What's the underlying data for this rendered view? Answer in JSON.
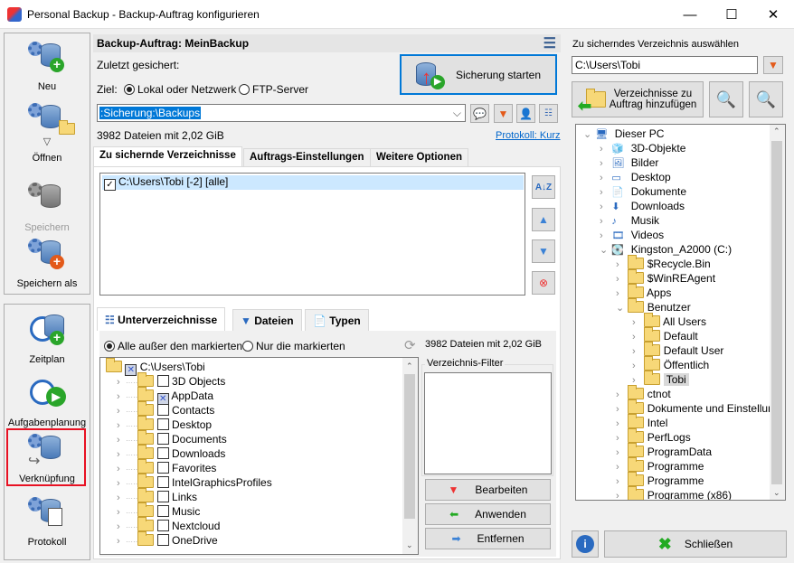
{
  "window": {
    "title": "Personal Backup - Backup-Auftrag konfigurieren",
    "minimize": "—",
    "maximize": "☐",
    "close": "✕"
  },
  "sidebar": {
    "items": [
      {
        "label": "Neu",
        "icon": "new-database-icon",
        "enabled": true
      },
      {
        "label": "Öffnen",
        "icon": "open-folder-icon",
        "enabled": true
      },
      {
        "label": "Speichern",
        "icon": "save-icon",
        "enabled": false
      },
      {
        "label": "Speichern als",
        "icon": "save-as-icon",
        "enabled": true
      },
      {
        "label": "Zeitplan",
        "icon": "clock-icon",
        "enabled": true
      },
      {
        "label": "Aufgabenplanung",
        "icon": "task-scheduler-icon",
        "enabled": true
      },
      {
        "label": "Verknüpfung",
        "icon": "shortcut-icon",
        "enabled": true,
        "highlighted": true
      },
      {
        "label": "Protokoll",
        "icon": "log-icon",
        "enabled": true
      }
    ]
  },
  "job": {
    "header": "Backup-Auftrag: MeinBackup",
    "last_saved_label": "Zuletzt gesichert:",
    "target_label": "Ziel:",
    "target_options": [
      "Lokal oder Netzwerk",
      "FTP-Server"
    ],
    "target_selected": "Lokal oder Netzwerk",
    "start_button": "Sicherung starten",
    "path": ":Sicherung:\\Backups",
    "summary": "3982 Dateien mit 2,02 GiB",
    "log_link": "Protokoll: Kurz"
  },
  "tabs": [
    "Zu sichernde Verzeichnisse",
    "Auftrags-Einstellungen",
    "Weitere Optionen"
  ],
  "dirs": [
    {
      "label": "C:\\Users\\Tobi [-2] [alle]",
      "checked": true
    }
  ],
  "subtabs": [
    "Unterverzeichnisse",
    "Dateien",
    "Typen"
  ],
  "filter_mode": {
    "options": [
      "Alle außer den markierten",
      "Nur die markierten"
    ],
    "selected": "Alle außer den markierten"
  },
  "subsummary": "3982 Dateien mit 2,02 GiB",
  "subtree": {
    "root": "C:\\Users\\Tobi",
    "items": [
      {
        "label": "3D Objects",
        "checked": false
      },
      {
        "label": "AppData",
        "checked": true
      },
      {
        "label": "Contacts",
        "checked": false
      },
      {
        "label": "Desktop",
        "checked": false
      },
      {
        "label": "Documents",
        "checked": false
      },
      {
        "label": "Downloads",
        "checked": false
      },
      {
        "label": "Favorites",
        "checked": false
      },
      {
        "label": "IntelGraphicsProfiles",
        "checked": false
      },
      {
        "label": "Links",
        "checked": false
      },
      {
        "label": "Music",
        "checked": false
      },
      {
        "label": "Nextcloud",
        "checked": false
      },
      {
        "label": "OneDrive",
        "checked": false
      }
    ]
  },
  "dir_filter": {
    "label": "Verzeichnis-Filter",
    "buttons": [
      "Bearbeiten",
      "Anwenden",
      "Entfernen"
    ]
  },
  "right": {
    "label": "Zu sicherndes Verzeichnis auswählen",
    "path": "C:\\Users\\Tobi",
    "add_button": "Verzeichnisse zu Auftrag hinzufügen",
    "close_button": "Schließen",
    "tree": [
      {
        "label": "Dieser PC",
        "level": 0,
        "open": true,
        "icon": "pc"
      },
      {
        "label": "3D-Objekte",
        "level": 1,
        "icon": "cube"
      },
      {
        "label": "Bilder",
        "level": 1,
        "icon": "pictures"
      },
      {
        "label": "Desktop",
        "level": 1,
        "icon": "desktop"
      },
      {
        "label": "Dokumente",
        "level": 1,
        "icon": "documents"
      },
      {
        "label": "Downloads",
        "level": 1,
        "icon": "downloads"
      },
      {
        "label": "Musik",
        "level": 1,
        "icon": "music"
      },
      {
        "label": "Videos",
        "level": 1,
        "icon": "videos"
      },
      {
        "label": "Kingston_A2000 (C:)",
        "level": 1,
        "open": true,
        "icon": "drive"
      },
      {
        "label": "$Recycle.Bin",
        "level": 2
      },
      {
        "label": "$WinREAgent",
        "level": 2
      },
      {
        "label": "Apps",
        "level": 2
      },
      {
        "label": "Benutzer",
        "level": 2,
        "open": true
      },
      {
        "label": "All Users",
        "level": 3
      },
      {
        "label": "Default",
        "level": 3
      },
      {
        "label": "Default User",
        "level": 3
      },
      {
        "label": "Öffentlich",
        "level": 3
      },
      {
        "label": "Tobi",
        "level": 3,
        "selected": true
      },
      {
        "label": "ctnot",
        "level": 2
      },
      {
        "label": "Dokumente und Einstellunge",
        "level": 2
      },
      {
        "label": "Intel",
        "level": 2
      },
      {
        "label": "PerfLogs",
        "level": 2
      },
      {
        "label": "ProgramData",
        "level": 2
      },
      {
        "label": "Programme",
        "level": 2
      },
      {
        "label": "Programme",
        "level": 2
      },
      {
        "label": "Programme (x86)",
        "level": 2
      }
    ]
  },
  "colors": {
    "accent": "#0078d7",
    "highlight_box": "#e81123",
    "selection": "#cce8ff",
    "link": "#0066cc"
  }
}
